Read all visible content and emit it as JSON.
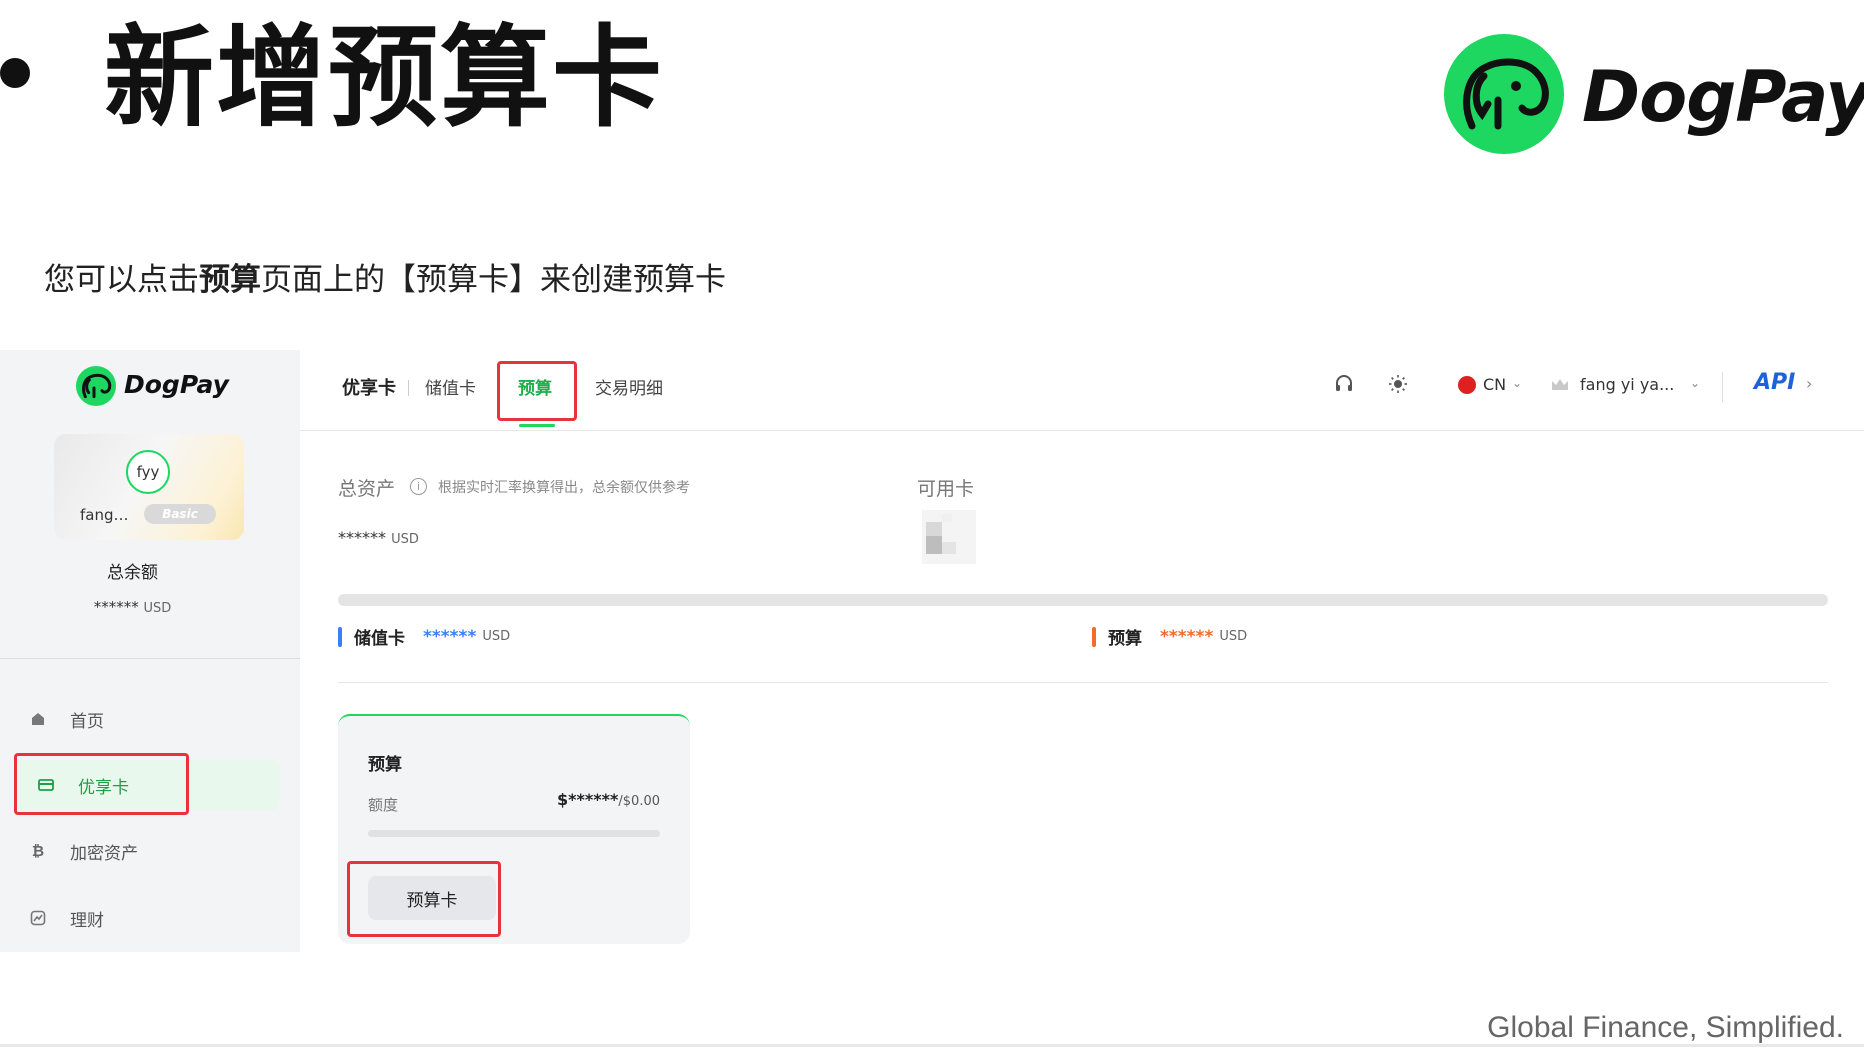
{
  "slide": {
    "title": "新增预算卡",
    "intro_before": "您可以点击",
    "intro_bold": "预算",
    "intro_after": "页面上的【预算卡】来创建预算卡",
    "brand": "DogPay",
    "tagline": "Global Finance, Simplified."
  },
  "sidebar": {
    "brand": "DogPay",
    "avatar_initials": "fyy",
    "user_short": "fang…",
    "tier_badge": "Basic",
    "total_label": "总余额",
    "total_value": "******",
    "total_unit": "USD",
    "nav": [
      {
        "label": "首页",
        "icon": "home-icon"
      },
      {
        "label": "优享卡",
        "icon": "card-icon",
        "active": true
      },
      {
        "label": "加密资产",
        "icon": "bitcoin-icon"
      },
      {
        "label": "理财",
        "icon": "finance-icon"
      }
    ]
  },
  "topbar": {
    "tabs": [
      "优享卡",
      "储值卡",
      "预算",
      "交易明细"
    ],
    "active_tab": "预算",
    "language": "CN",
    "user": "fang yi ya...",
    "api_label": "API"
  },
  "overview": {
    "assets_label": "总资产",
    "assets_note": "根据实时汇率换算得出，总余额仅供参考",
    "assets_value": "******",
    "assets_unit": "USD",
    "available_label": "可用卡"
  },
  "legend": {
    "stored": {
      "label": "储值卡",
      "value": "******",
      "unit": "USD",
      "color": "#3c7ef6"
    },
    "budget": {
      "label": "预算",
      "value": "******",
      "unit": "USD",
      "color": "#f36b2c"
    }
  },
  "budget_card": {
    "title": "预算",
    "limit_label": "额度",
    "amount": "$******",
    "amount_suffix": "/$0.00",
    "button_label": "预算卡"
  },
  "colors": {
    "brand_green": "#1ed760",
    "active_green": "#1eae4c",
    "highlight_red": "#e8333d",
    "api_blue": "#1e62d6"
  }
}
